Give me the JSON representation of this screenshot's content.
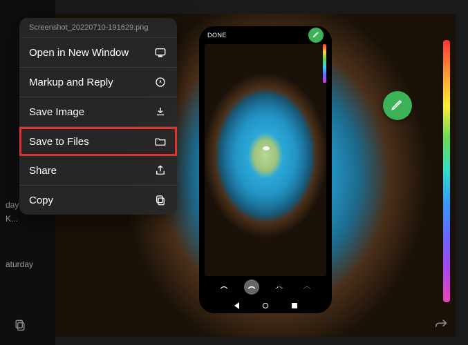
{
  "context_menu": {
    "file_name": "Screenshot_20220710-191629.png",
    "items": [
      {
        "label": "Open in New Window",
        "icon": "window-icon",
        "highlighted": false
      },
      {
        "label": "Markup and Reply",
        "icon": "markup-icon",
        "highlighted": false
      },
      {
        "label": "Save Image",
        "icon": "download-icon",
        "highlighted": false
      },
      {
        "label": "Save to Files",
        "icon": "folder-icon",
        "highlighted": true
      },
      {
        "label": "Share",
        "icon": "share-icon",
        "highlighted": false
      },
      {
        "label": "Copy",
        "icon": "copy-icon",
        "highlighted": false
      }
    ]
  },
  "phone_preview": {
    "done_label": "DONE"
  },
  "sidebar_hints": [
    "day",
    "K...",
    "aturday"
  ]
}
